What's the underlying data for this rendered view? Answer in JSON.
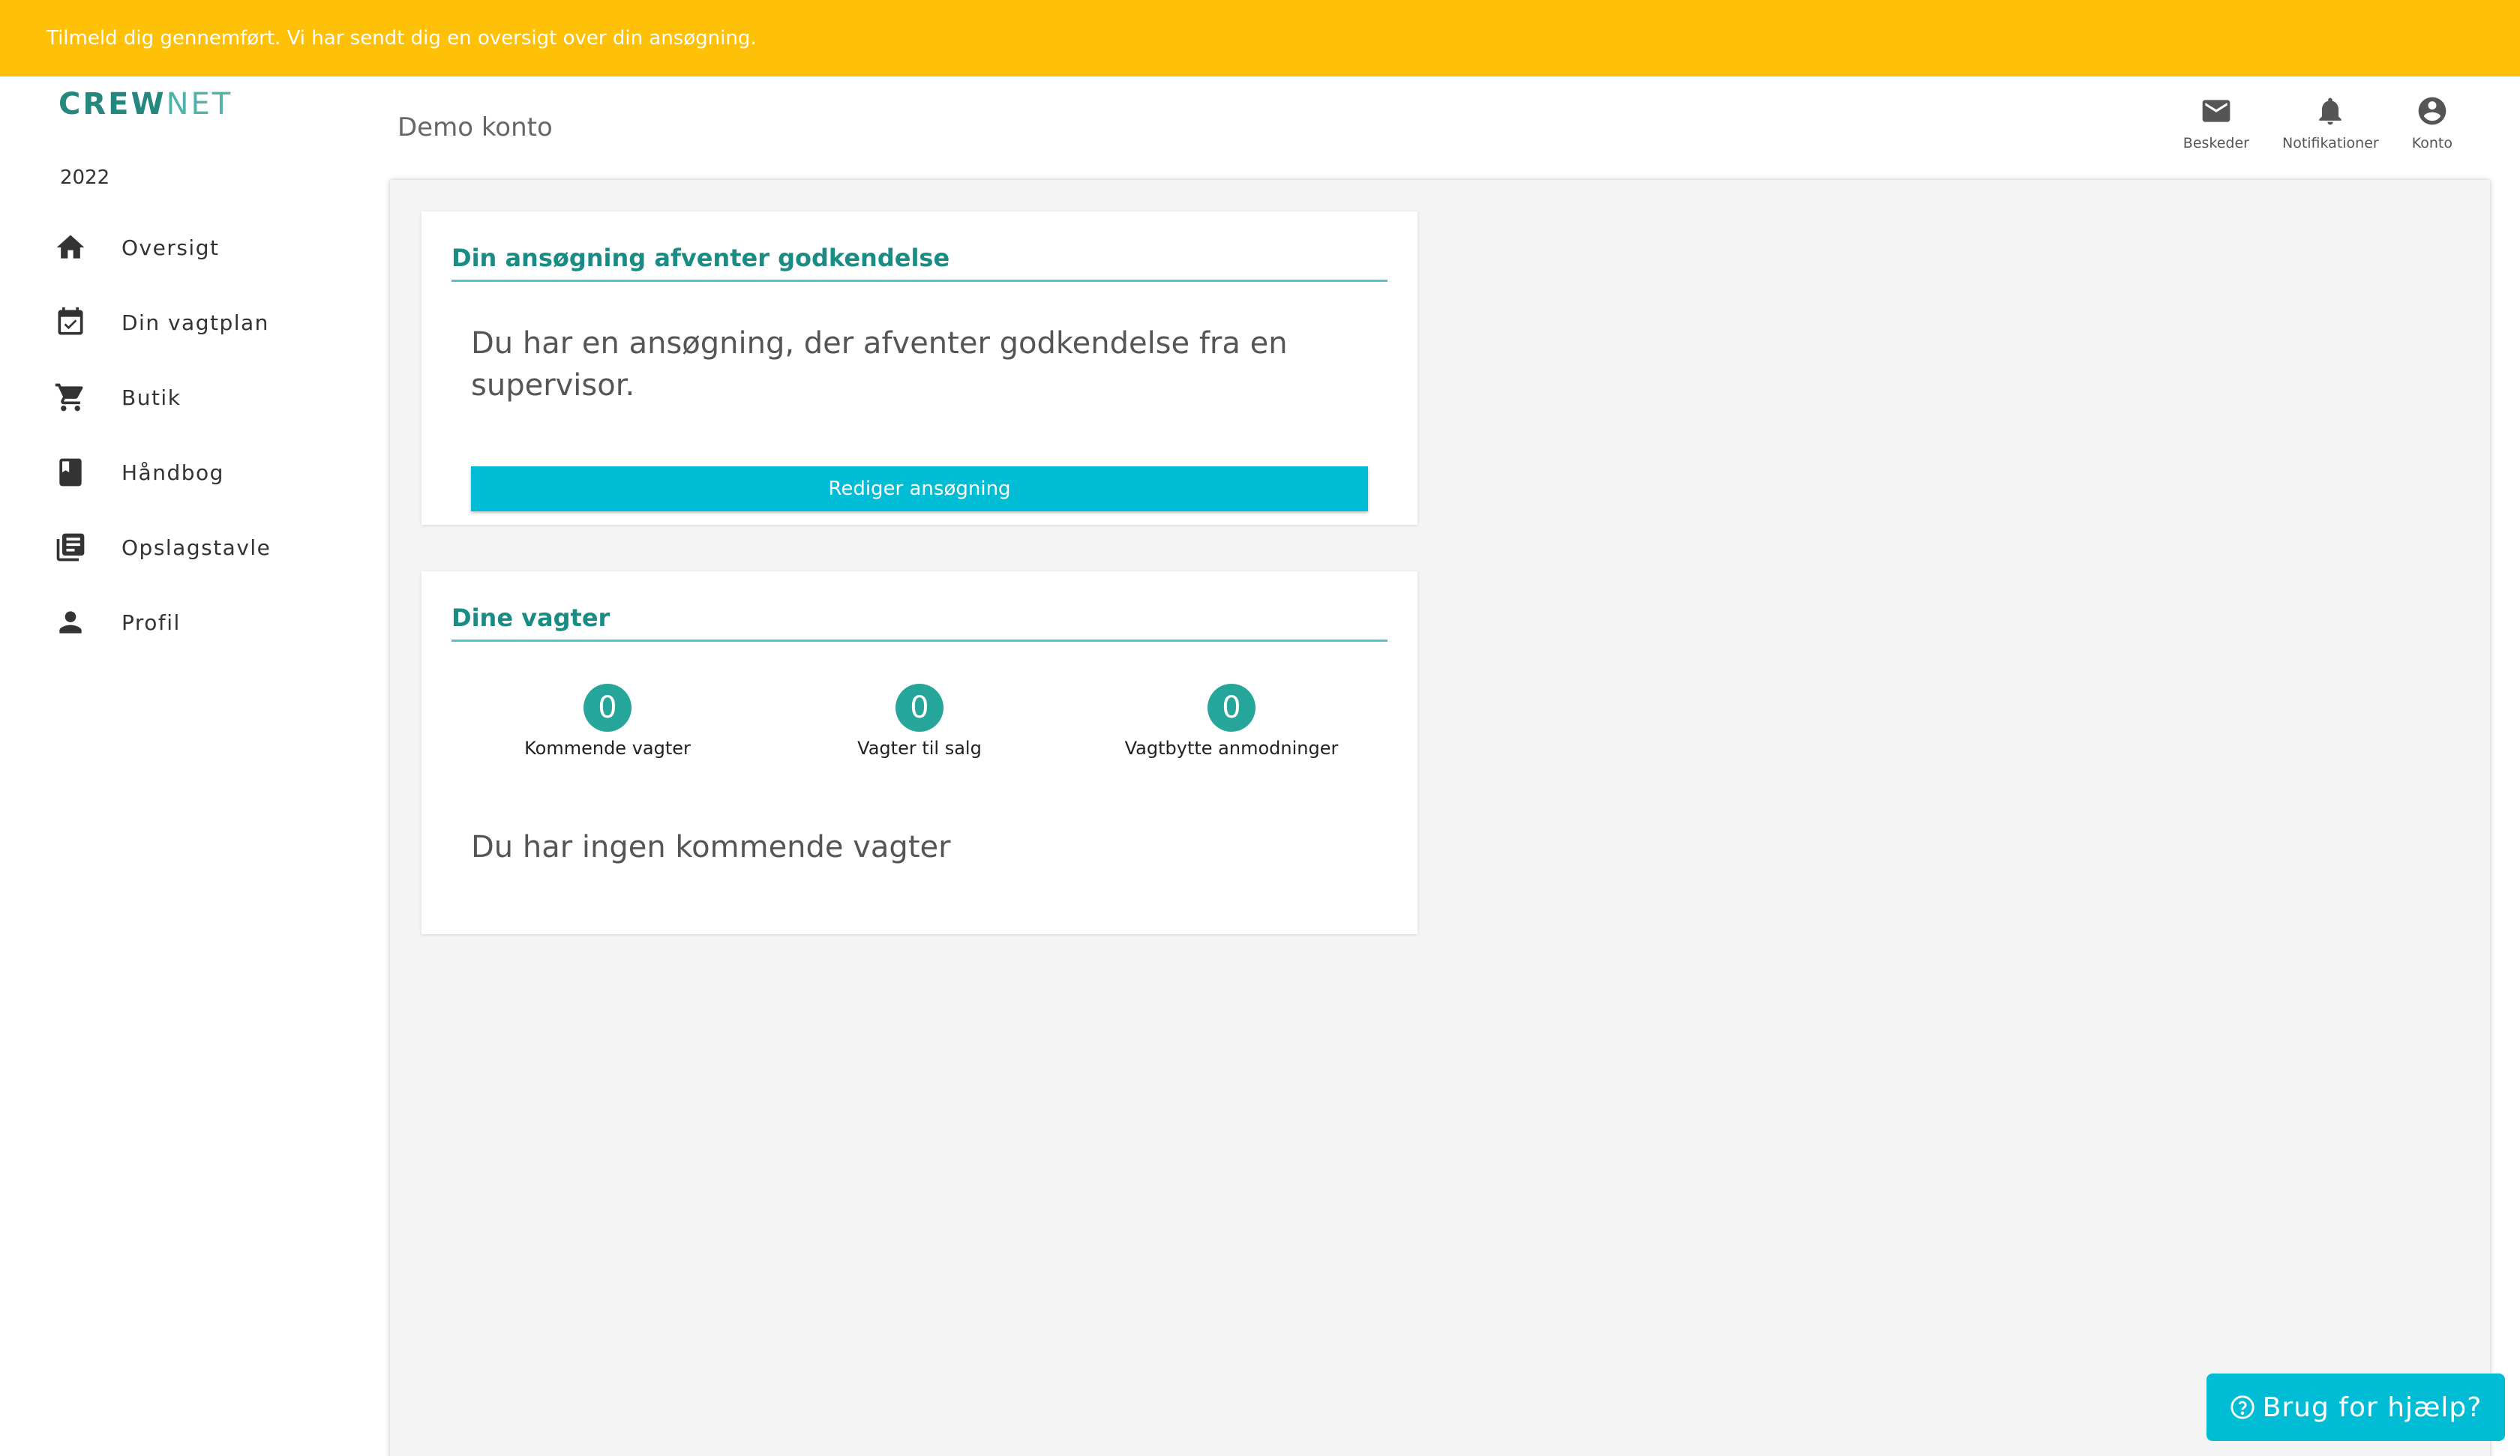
{
  "banner": {
    "text": "Tilmeld dig gennemført. Vi har sendt dig en oversigt over din ansøgning."
  },
  "brand": {
    "logo_part1": "CREW",
    "logo_part2": "NET"
  },
  "sidebar": {
    "year": "2022",
    "items": [
      {
        "label": "Oversigt",
        "icon": "home-icon"
      },
      {
        "label": "Din vagtplan",
        "icon": "calendar-check-icon"
      },
      {
        "label": "Butik",
        "icon": "cart-icon"
      },
      {
        "label": "Håndbog",
        "icon": "book-icon"
      },
      {
        "label": "Opslagstavle",
        "icon": "bulletin-board-icon"
      },
      {
        "label": "Profil",
        "icon": "person-icon"
      }
    ]
  },
  "header": {
    "title": "Demo konto",
    "actions": [
      {
        "label": "Beskeder",
        "icon": "mail-icon"
      },
      {
        "label": "Notifikationer",
        "icon": "bell-icon"
      },
      {
        "label": "Konto",
        "icon": "account-circle-icon"
      }
    ]
  },
  "application_card": {
    "title": "Din ansøgning afventer godkendelse",
    "text": "Du har en ansøgning, der afventer godkendelse fra en supervisor.",
    "button_label": "Rediger ansøgning"
  },
  "shifts_card": {
    "title": "Dine vagter",
    "stats": [
      {
        "count": "0",
        "label": "Kommende vagter"
      },
      {
        "count": "0",
        "label": "Vagter til salg"
      },
      {
        "count": "0",
        "label": "Vagtbytte anmodninger"
      }
    ],
    "empty_text": "Du har ingen kommende vagter"
  },
  "help": {
    "label": "Brug for hjælp?"
  },
  "colors": {
    "banner": "#ffc107",
    "accent": "#00bcd4",
    "teal": "#26a69a",
    "brand": "#26877e"
  }
}
